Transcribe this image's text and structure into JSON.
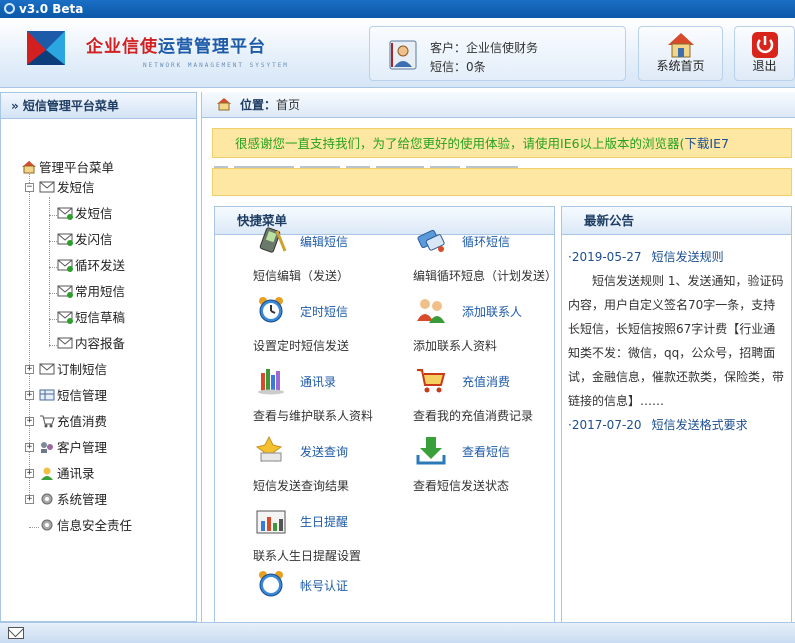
{
  "window": {
    "title": "v3.0 Beta"
  },
  "brand": {
    "name_red": "企业信使",
    "name_blue": "运营管理平台",
    "subtitle": "NETWORK MANAGEMENT SYSYTEM"
  },
  "user": {
    "line1": "客户：企业信使财务",
    "line2": "短信：0条"
  },
  "header_buttons": {
    "home": "系统首页",
    "logout": "退出"
  },
  "sidebar": {
    "title": "» 短信管理平台菜单",
    "root": "管理平台菜单",
    "group_send": "发短信",
    "send_items": [
      "发短信",
      "发闪信",
      "循环发送",
      "常用短信",
      "短信草稿",
      "内容报备"
    ],
    "groups": [
      "订制短信",
      "短信管理",
      "充值消费",
      "客户管理",
      "通讯录",
      "系统管理",
      "信息安全责任"
    ]
  },
  "breadcrumb": {
    "label": "位置：",
    "value": "首页"
  },
  "notice": {
    "text": "很感谢您一直支持我们，为了给您更好的使用体验，请使用IE6以上版本的浏览器(",
    "link": "下载IE7"
  },
  "quick_menu": {
    "title": "快捷菜单",
    "items": [
      {
        "title": "编辑短信",
        "desc": "短信编辑（发送）",
        "icon": "phone-edit-icon"
      },
      {
        "title": "循环短信",
        "desc": "编辑循环短息（计划发送）",
        "icon": "loop-sms-icon"
      },
      {
        "title": "定时短信",
        "desc": "设置定时短信发送",
        "icon": "alarm-clock-icon"
      },
      {
        "title": "添加联系人",
        "desc": "添加联系人资料",
        "icon": "add-contact-icon"
      },
      {
        "title": "通讯录",
        "desc": "查看与维护联系人资料",
        "icon": "address-book-icon"
      },
      {
        "title": "充值消费",
        "desc": "查看我的充值消费记录",
        "icon": "shopping-cart-icon"
      },
      {
        "title": "发送查询",
        "desc": "短信发送查询结果",
        "icon": "send-query-icon"
      },
      {
        "title": "查看短信",
        "desc": "查看短信发送状态",
        "icon": "download-icon"
      },
      {
        "title": "生日提醒",
        "desc": "联系人生日提醒设置",
        "icon": "birthday-icon"
      },
      {
        "title": "帐号认证",
        "desc": "",
        "icon": "alarm-clock-icon"
      }
    ]
  },
  "news": {
    "title": "最新公告",
    "items": [
      {
        "date": "·2019-05-27",
        "title": "短信发送规则",
        "body": "短信发送规则 1、发送通知，验证码内容，用户自定义签名70字一条，支持长短信，长短信按照67字计费【行业通知类不发：微信，qq，公众号，招聘面试，金融信息，催款还款类，保险类，带链接的信息】……"
      },
      {
        "date": "·2017-07-20",
        "title": "短信发送格式要求",
        "body": ""
      }
    ]
  },
  "colors": {
    "brand_red": "#d21f1f",
    "brand_blue": "#1d5aa8",
    "notice_bg": "#fde7a2",
    "notice_text": "#27a21f"
  }
}
